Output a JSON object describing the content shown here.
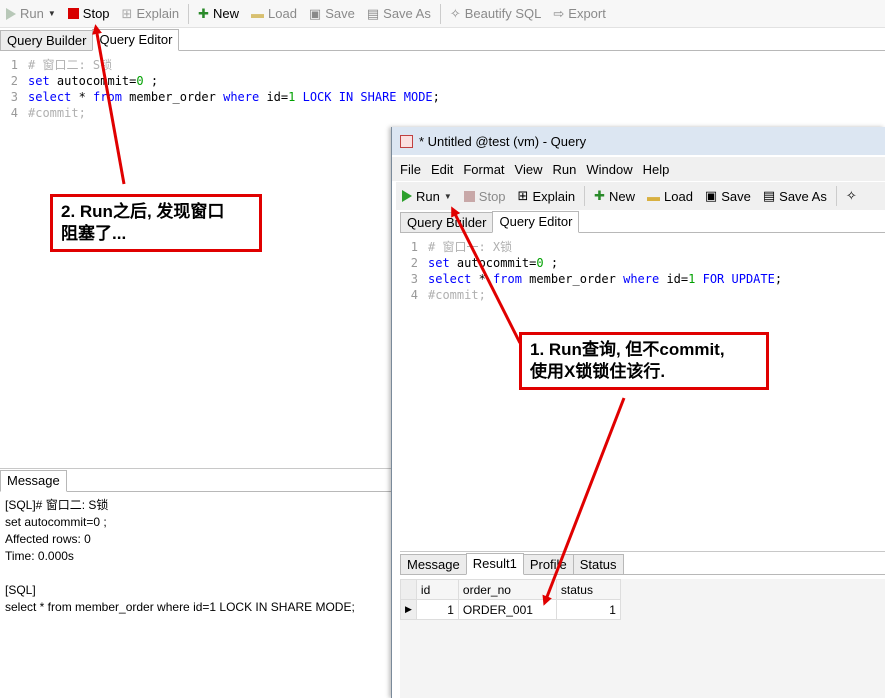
{
  "back": {
    "toolbar": {
      "run": "Run",
      "stop": "Stop",
      "explain": "Explain",
      "new": "New",
      "load": "Load",
      "save": "Save",
      "save_as": "Save As",
      "beautify": "Beautify SQL",
      "export": "Export"
    },
    "tabs": [
      "Query Builder",
      "Query Editor"
    ],
    "lines": [
      {
        "n": "1",
        "text": "# 窗口二: S锁"
      },
      {
        "n": "2",
        "kw1": "set",
        "rest": " autocommit=0 ;"
      },
      {
        "n": "3",
        "sql": "select * from member_order where id=1 LOCK IN SHARE MODE;"
      },
      {
        "n": "4",
        "text": "#commit;"
      }
    ],
    "message_tab": "Message",
    "messages": [
      "[SQL]# 窗口二: S锁",
      "set autocommit=0 ;",
      "Affected rows: 0",
      "Time: 0.000s",
      "",
      "[SQL]",
      "select * from member_order where id=1 LOCK IN SHARE MODE;"
    ]
  },
  "front": {
    "title": "* Untitled @test (vm) - Query",
    "menu": [
      "File",
      "Edit",
      "Format",
      "View",
      "Run",
      "Window",
      "Help"
    ],
    "toolbar": {
      "run": "Run",
      "stop": "Stop",
      "explain": "Explain",
      "new": "New",
      "load": "Load",
      "save": "Save",
      "save_as": "Save As"
    },
    "tabs": [
      "Query Builder",
      "Query Editor"
    ],
    "lines": [
      {
        "n": "1",
        "text": "# 窗口一: X锁"
      },
      {
        "n": "2"
      },
      {
        "n": "3"
      },
      {
        "n": "4",
        "text": "#commit;"
      }
    ],
    "result_tabs": [
      "Message",
      "Result1",
      "Profile",
      "Status"
    ],
    "columns": [
      "id",
      "order_no",
      "status"
    ],
    "rows": [
      [
        "1",
        "ORDER_001",
        "1"
      ]
    ]
  },
  "callouts": {
    "one": "1. Run查询, 但不commit,\n使用X锁锁住该行.",
    "two": "2. Run之后, 发现窗口\n阻塞了..."
  },
  "colors": {
    "arrow": "#e00000",
    "keyword": "#0000ff",
    "number": "#00a000",
    "comment": "#b0b0b0"
  }
}
